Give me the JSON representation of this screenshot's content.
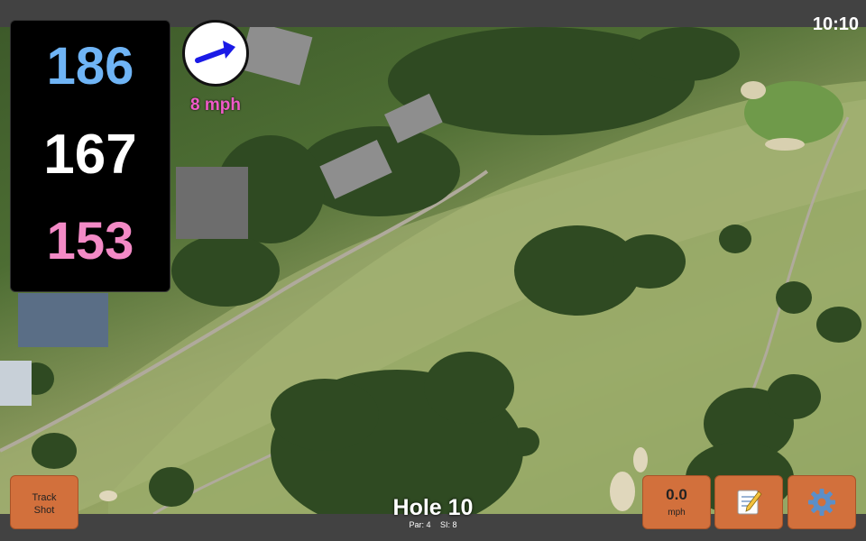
{
  "status_bar": {
    "time": "10:10"
  },
  "distances": {
    "back": "186",
    "middle": "167",
    "front": "153"
  },
  "wind": {
    "speed_label": "8 mph",
    "direction_icon": "arrow-icon"
  },
  "buttons": {
    "track_shot_line1": "Track",
    "track_shot_line2": "Shot",
    "speed_value": "0.0",
    "speed_unit": "mph",
    "notes_icon": "notepad-icon",
    "settings_icon": "gear-icon"
  },
  "hole": {
    "title": "Hole 10",
    "par": "Par: 4",
    "si": "SI: 8"
  },
  "colors": {
    "back": "#6fb4f5",
    "middle": "#ffffff",
    "front": "#f38ac6",
    "wind": "#f05ac8",
    "button": "#d2703c"
  }
}
